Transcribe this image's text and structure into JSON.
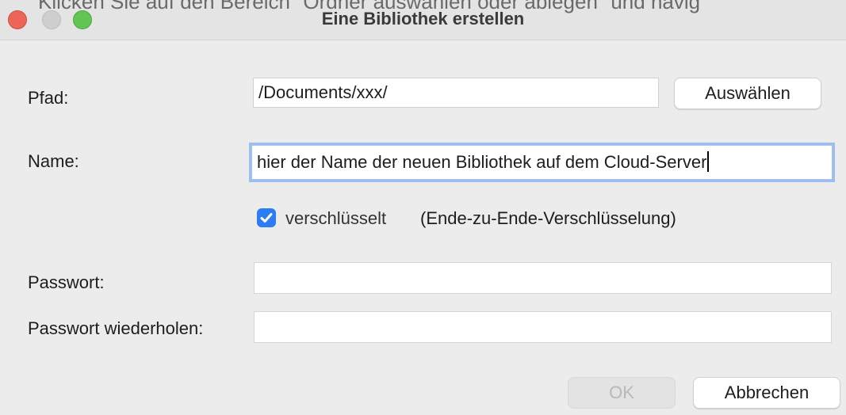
{
  "window": {
    "title": "Eine Bibliothek erstellen",
    "background_text": "Klicken Sie auf den Bereich \"Ordner auswählen oder ablegen\" und navig"
  },
  "form": {
    "path_label": "Pfad:",
    "path_value": "/Documents/xxx/",
    "choose_button": "Auswählen",
    "name_label": "Name:",
    "name_value": "hier der Name der neuen Bibliothek auf dem Cloud-Server",
    "encrypted_checked": true,
    "encrypted_label": "verschlüsselt",
    "encrypted_note": "(Ende-zu-Ende-Verschlüsselung)",
    "password_label": "Passwort:",
    "password_value": "",
    "password_repeat_label": "Passwort wiederholen:",
    "password_repeat_value": ""
  },
  "buttons": {
    "ok": "OK",
    "cancel": "Abbrechen"
  },
  "colors": {
    "accent": "#2c7cf6",
    "close": "#ec6559",
    "maximize": "#61c554",
    "focus_ring": "#9cbdf0"
  },
  "icons": {
    "checkbox": "checkmark-icon"
  }
}
